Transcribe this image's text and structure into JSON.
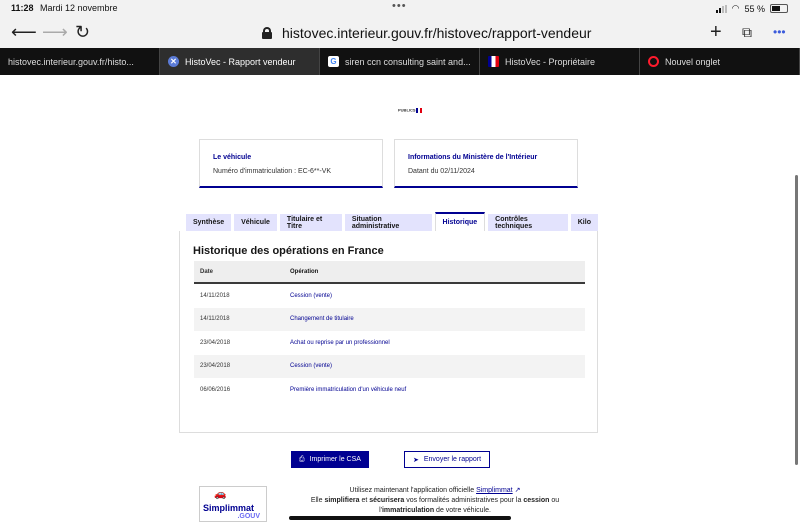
{
  "status_bar": {
    "time": "11:28",
    "date": "Mardi 12 novembre",
    "battery": "55 %"
  },
  "toolbar": {
    "url": "histovec.interieur.gouv.fr/histovec/rapport-vendeur",
    "back_icon": "back-arrow-icon",
    "forward_icon": "forward-arrow-icon",
    "reload_icon": "reload-icon",
    "new_tab_icon": "plus-icon",
    "tabs_icon": "tabs-icon",
    "more_icon": "more-icon"
  },
  "browser_tabs": [
    {
      "title": "histovec.interieur.gouv.fr/histo...",
      "favicon": "none",
      "active": false
    },
    {
      "title": "HistoVec - Rapport vendeur",
      "favicon": "close-icon",
      "active": true
    },
    {
      "title": "siren ccn consulting saint and...",
      "favicon": "google-icon",
      "active": false
    },
    {
      "title": "HistoVec - Propriétaire",
      "favicon": "marianne-icon",
      "active": false
    },
    {
      "title": "Nouvel onglet",
      "favicon": "opera-icon",
      "active": false
    }
  ],
  "page": {
    "logo_text": "PUBLICS",
    "vehicle_card": {
      "title": "Le véhicule",
      "subtitle": "Numéro d'immatriculation : EC-6**-VK"
    },
    "ministry_card": {
      "title": "Informations du Ministère de l'Intérieur",
      "subtitle": "Datant du 02/11/2024"
    },
    "tabs": [
      "Synthèse",
      "Véhicule",
      "Titulaire et Titre",
      "Situation administrative",
      "Historique",
      "Contrôles techniques",
      "Kilo"
    ],
    "active_tab": "Historique",
    "section_title": "Historique des opérations en France",
    "table": {
      "headers": [
        "Date",
        "Opération"
      ],
      "rows": [
        [
          "14/11/2018",
          "Cession (vente)"
        ],
        [
          "14/11/2018",
          "Changement de titulaire"
        ],
        [
          "23/04/2018",
          "Achat ou reprise par un professionnel"
        ],
        [
          "23/04/2018",
          "Cession (vente)"
        ],
        [
          "06/06/2016",
          "Première immatriculation d'un véhicule neuf"
        ]
      ]
    },
    "buttons": {
      "print": "Imprimer le CSA",
      "send": "Envoyer le rapport"
    },
    "simplimmat": {
      "name": "Simplimmat",
      "suffix": ".GOUV"
    },
    "promo": {
      "line1_prefix": "Utilisez maintenant l'application officielle",
      "line1_link": "Simplimmat",
      "line2_a": "Elle",
      "line2_b": "simplifiera",
      "line2_c": "et",
      "line2_d": "sécurisera",
      "line2_e": "vos formalités administratives pour la",
      "line2_f": "cession",
      "line2_g": "ou",
      "line3_a": "l'",
      "line3_b": "immatriculation",
      "line3_c": "de votre véhicule."
    }
  },
  "colors": {
    "brand": "#000091",
    "tab_bg": "#e3e3fd",
    "browser_tabs_bg": "#1d1d1d"
  }
}
